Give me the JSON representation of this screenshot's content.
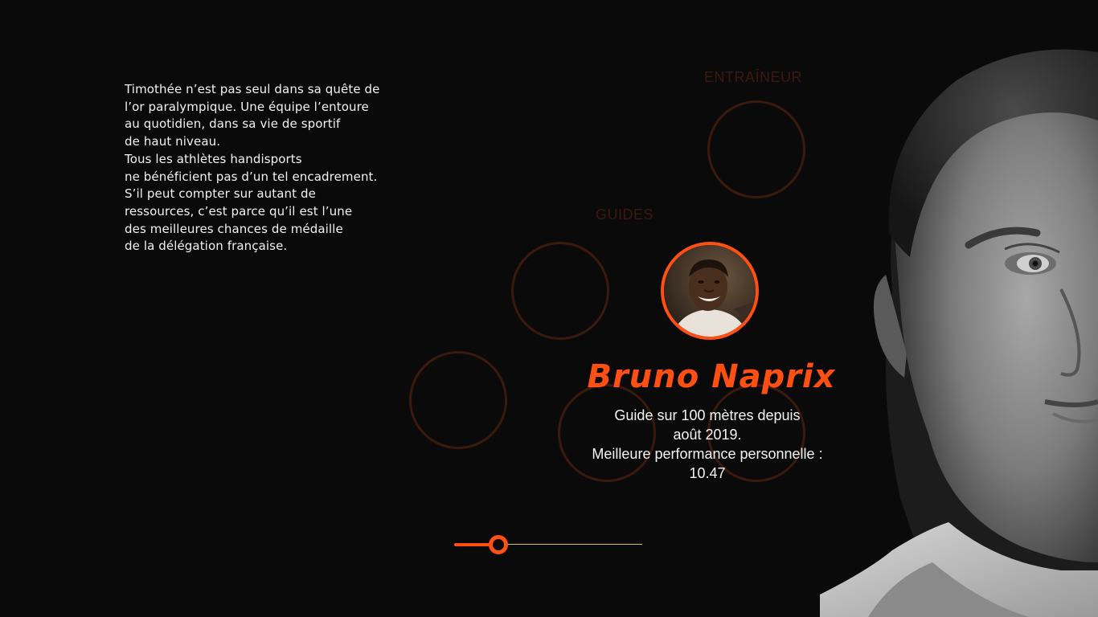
{
  "intro": {
    "lines": [
      "Timothée n’est pas seul dans sa quête de",
      "l’or paralympique. Une équipe l’entoure",
      "au quotidien, dans sa vie de sportif",
      "de haut niveau.",
      "Tous les athlètes handisports",
      "ne bénéficient pas d’un tel encadrement.",
      "S’il peut compter sur autant de",
      "ressources, c’est parce qu’il est l’une",
      "des meilleures chances de médaille",
      "de la délégation française."
    ]
  },
  "categories": {
    "coach": "ENTRAÎNEUR",
    "guides": "GUIDES"
  },
  "featured": {
    "name": "Bruno Naprix",
    "description_lines": [
      "Guide sur 100 mètres depuis",
      "août 2019.",
      "Meilleure performance personnelle :",
      "10.47"
    ]
  },
  "timeline": {
    "progress": 0.25
  },
  "colors": {
    "accent": "#ff4f12",
    "background": "#0b0a0a",
    "ring": "#3b1a0e",
    "category_text": "#3a1a10",
    "timeline_line": "#d4c25a"
  },
  "icons": {
    "avatar": "guide-portrait-photo",
    "portrait": "athlete-portrait-photo"
  }
}
